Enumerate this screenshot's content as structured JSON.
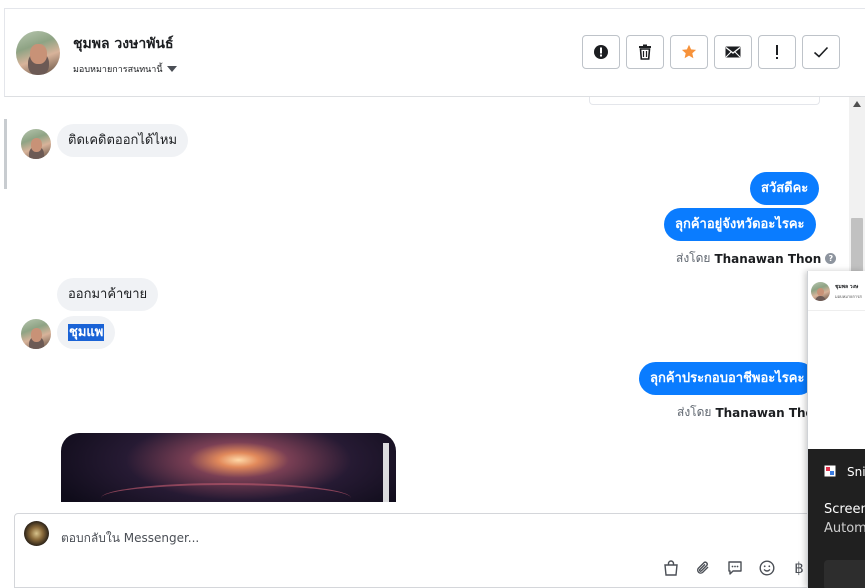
{
  "header": {
    "contact_name": "ชุมพล วงษาพันธ์",
    "assign_label": "มอบหมายการสนทนานี้",
    "actions": [
      {
        "name": "report-icon",
        "title": "!"
      },
      {
        "name": "trash-icon",
        "title": "delete"
      },
      {
        "name": "star-icon",
        "title": "star"
      },
      {
        "name": "mail-icon",
        "title": "mail"
      },
      {
        "name": "exclamation-icon",
        "title": "!"
      },
      {
        "name": "check-icon",
        "title": "done"
      }
    ],
    "star_color": "#f7923a"
  },
  "messages": {
    "m1": "ติดเคดิตออกได้ไหม",
    "m2": "สวัสดีคะ",
    "m3": "ลุกค้าอยู่จังหวัดอะไรคะ",
    "sent_by_1": {
      "prefix": "ส่งโดย",
      "name": "Thanawan Thon"
    },
    "m4": "ออกมาค้าขาย",
    "m5": "ชุมแพ",
    "m6": "ลุกค้าประกอบอาชีพอะไรคะ",
    "sent_by_2": {
      "prefix": "ส่งโดย",
      "name": "Thanawan Thon"
    },
    "outgoing_color": "#0a7cff",
    "incoming_color": "#f0f2f5"
  },
  "reply": {
    "placeholder": "ตอบกลับใน Messenger...",
    "tools": [
      "bag-icon",
      "paperclip-icon",
      "saved-reply-icon",
      "emoji-icon",
      "baht-icon"
    ]
  },
  "snip_overlay": {
    "thumb_name": "ชุมพล วงษ",
    "thumb_sub": "มอบหมายการส",
    "title": "Snip",
    "line1": "Screen",
    "line2": "Autom"
  }
}
